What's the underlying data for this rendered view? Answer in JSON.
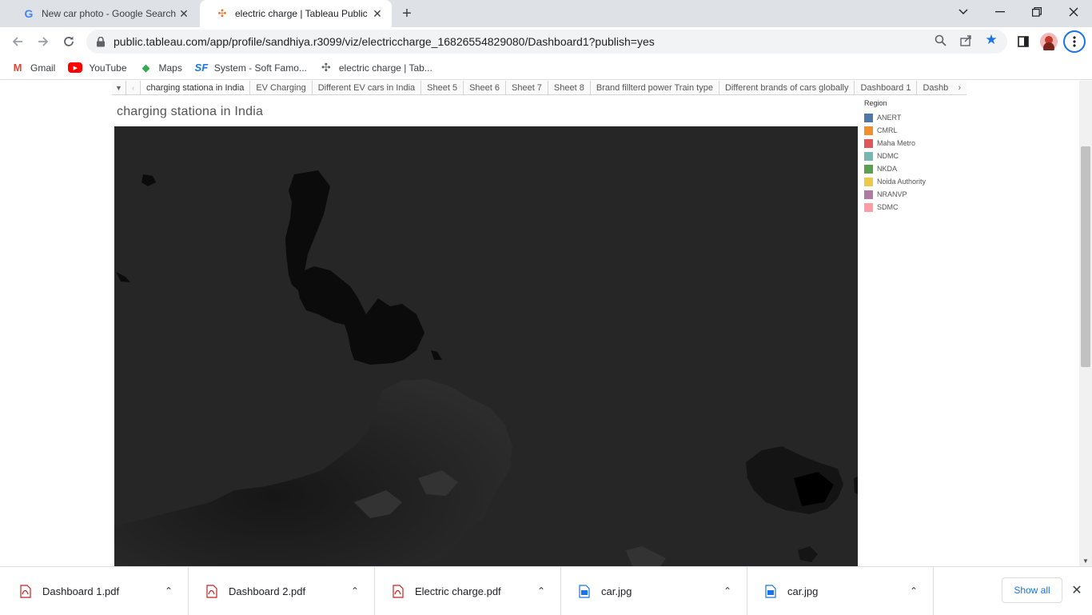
{
  "browser": {
    "tabs": [
      {
        "title": "New car photo - Google Search",
        "icon": "google-icon",
        "active": false
      },
      {
        "title": "electric charge | Tableau Public",
        "icon": "tableau-icon",
        "active": true
      }
    ],
    "url": "public.tableau.com/app/profile/sandhiya.r3099/viz/electriccharge_16826554829080/Dashboard1?publish=yes",
    "bookmarks": [
      {
        "label": "Gmail",
        "icon": "gmail-icon",
        "icon_glyph": "M",
        "color": "#ea4335"
      },
      {
        "label": "YouTube",
        "icon": "youtube-icon",
        "icon_glyph": "▶",
        "color": "#ff0000"
      },
      {
        "label": "Maps",
        "icon": "maps-icon",
        "icon_glyph": "◆",
        "color": "#34a853"
      },
      {
        "label": "System - Soft Famo...",
        "icon": "sf-icon",
        "icon_glyph": "SF",
        "color": "#1a73e8"
      },
      {
        "label": "electric charge | Tab...",
        "icon": "tableau-icon",
        "icon_glyph": "✣",
        "color": "#5f6368"
      }
    ]
  },
  "tableau": {
    "sheet_tabs": [
      {
        "label": "charging stationa in India",
        "active": true
      },
      {
        "label": "EV Charging",
        "active": false
      },
      {
        "label": "Different EV cars in India",
        "active": false
      },
      {
        "label": "Sheet 5",
        "active": false
      },
      {
        "label": "Sheet 6",
        "active": false
      },
      {
        "label": "Sheet 7",
        "active": false
      },
      {
        "label": "Sheet 8",
        "active": false
      },
      {
        "label": "Brand fillterd power Train type",
        "active": false
      },
      {
        "label": "Different brands of cars globally",
        "active": false
      },
      {
        "label": "Dashboard 1",
        "active": false
      },
      {
        "label": "Dashb",
        "active": false
      }
    ],
    "viz_title": "charging stationa in India",
    "legend": {
      "title": "Region",
      "items": [
        {
          "label": "ANERT",
          "color": "#4e79a7"
        },
        {
          "label": "CMRL",
          "color": "#f28e2b"
        },
        {
          "label": "Maha Metro",
          "color": "#e15759"
        },
        {
          "label": "NDMC",
          "color": "#76b7b2"
        },
        {
          "label": "NKDA",
          "color": "#59a14f"
        },
        {
          "label": "Noida Authority",
          "color": "#edc948"
        },
        {
          "label": "NRANVP",
          "color": "#b07aa1"
        },
        {
          "label": "SDMC",
          "color": "#ff9da7"
        }
      ]
    }
  },
  "downloads": {
    "items": [
      {
        "name": "Dashboard 1.pdf",
        "type": "pdf"
      },
      {
        "name": "Dashboard 2.pdf",
        "type": "pdf"
      },
      {
        "name": "Electric charge.pdf",
        "type": "pdf"
      },
      {
        "name": "car.jpg",
        "type": "image"
      },
      {
        "name": "car.jpg",
        "type": "image"
      }
    ],
    "show_all_label": "Show all"
  }
}
